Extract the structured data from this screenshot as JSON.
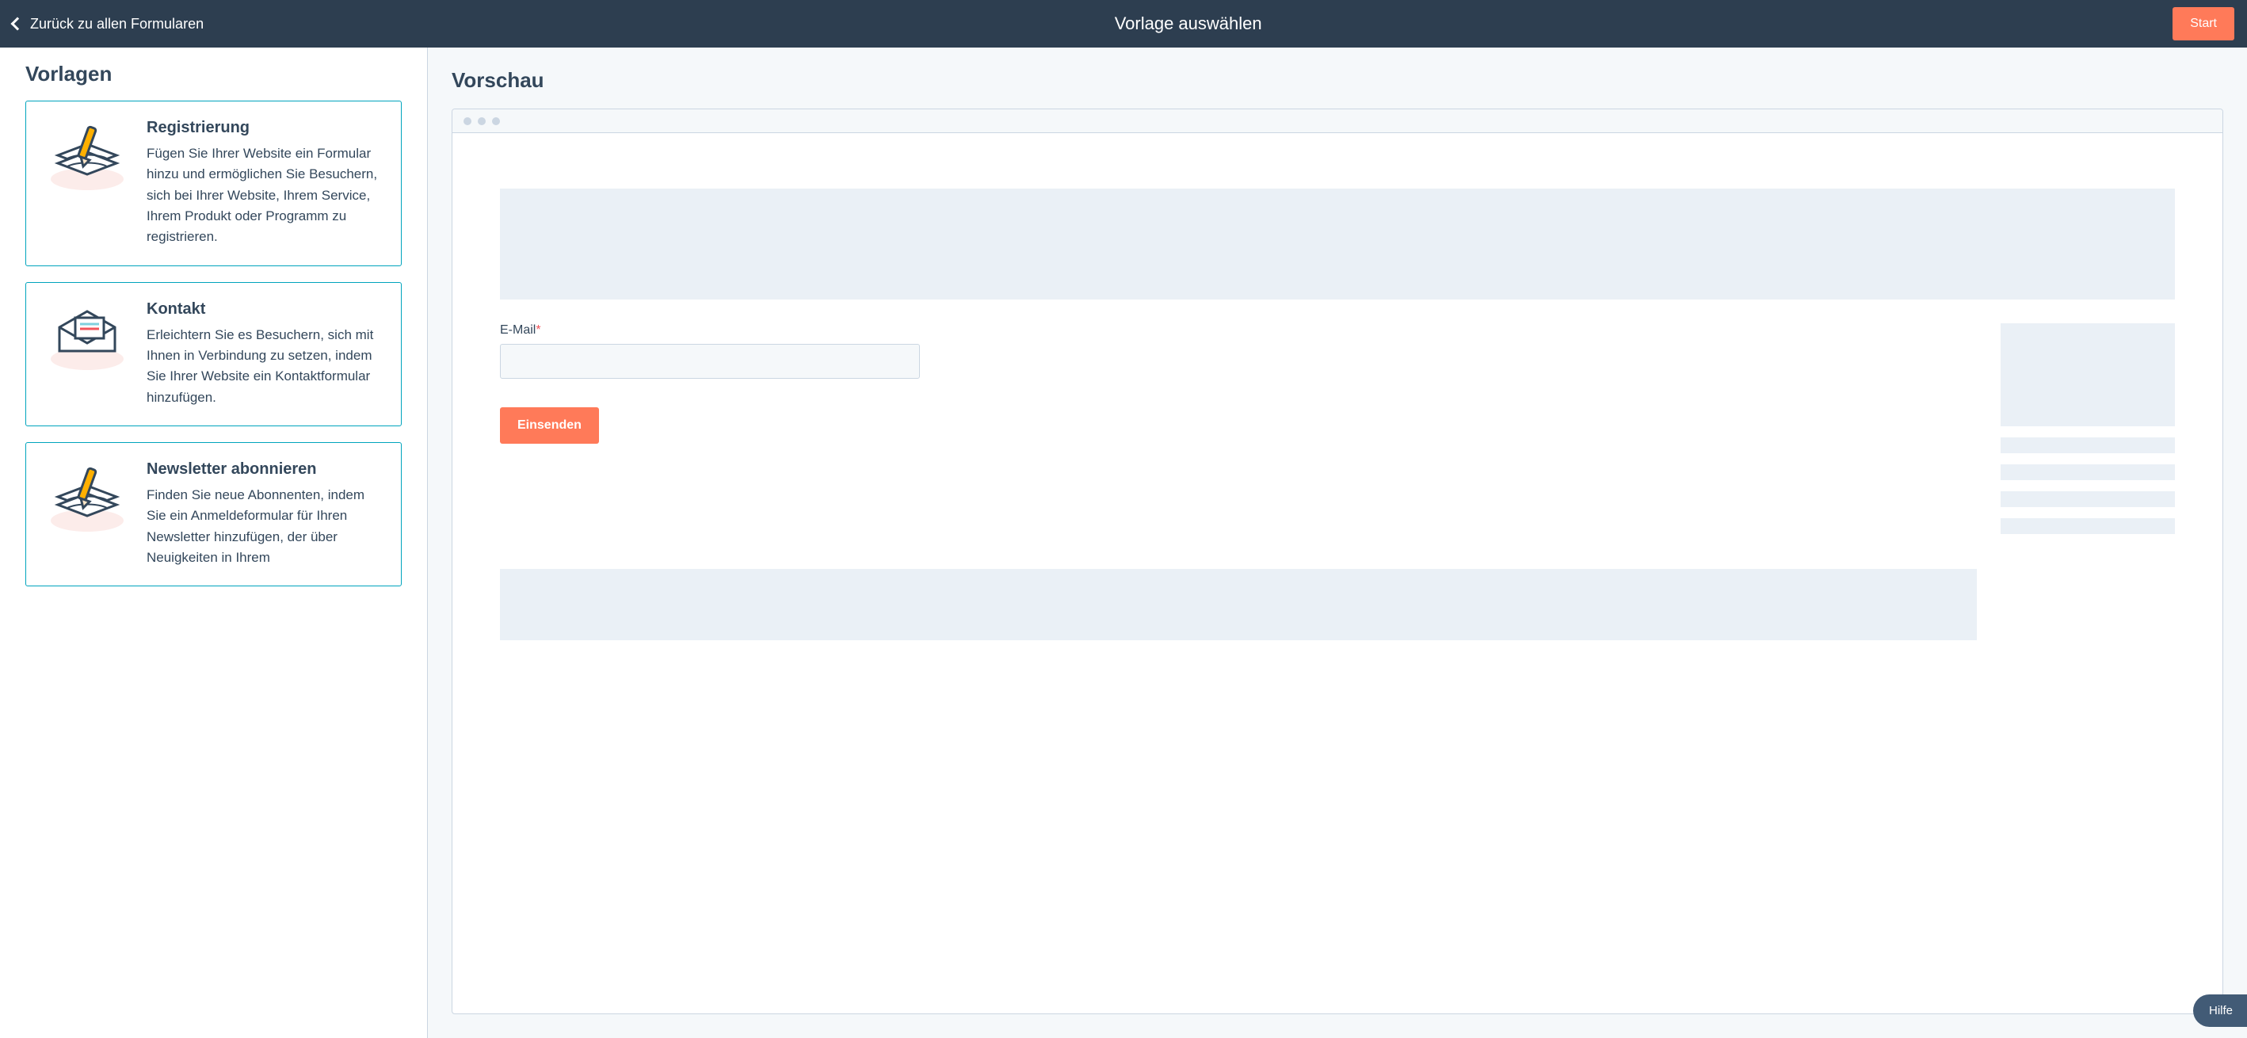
{
  "header": {
    "back_label": "Zurück zu allen Formularen",
    "title": "Vorlage auswählen",
    "start_label": "Start"
  },
  "sidebar": {
    "title": "Vorlagen",
    "templates": [
      {
        "title": "Registrierung",
        "desc": "Fügen Sie Ihrer Website ein Formular hinzu und ermöglichen Sie Besuchern, sich bei Ihrer Website, Ihrem Service, Ihrem Produkt oder Programm zu registrieren.",
        "icon": "form-pencil-icon"
      },
      {
        "title": "Kontakt",
        "desc": "Erleichtern Sie es Besuchern, sich mit Ihnen in Verbindung zu setzen, indem Sie Ihrer Website ein Kontaktformular hinzufügen.",
        "icon": "envelope-icon"
      },
      {
        "title": "Newsletter abonnieren",
        "desc": "Finden Sie neue Abonnenten, indem Sie ein Anmeldeformular für Ihren Newsletter hinzufügen, der über Neuigkeiten in Ihrem",
        "icon": "form-pencil-icon"
      }
    ]
  },
  "preview": {
    "title": "Vorschau",
    "form": {
      "email_label": "E-Mail",
      "submit_label": "Einsenden"
    }
  },
  "help_label": "Hilfe",
  "colors": {
    "accent": "#ff7a59",
    "teal": "#00a4bd",
    "darkbar": "#2d3e50",
    "placeholder": "#eaf0f6"
  }
}
